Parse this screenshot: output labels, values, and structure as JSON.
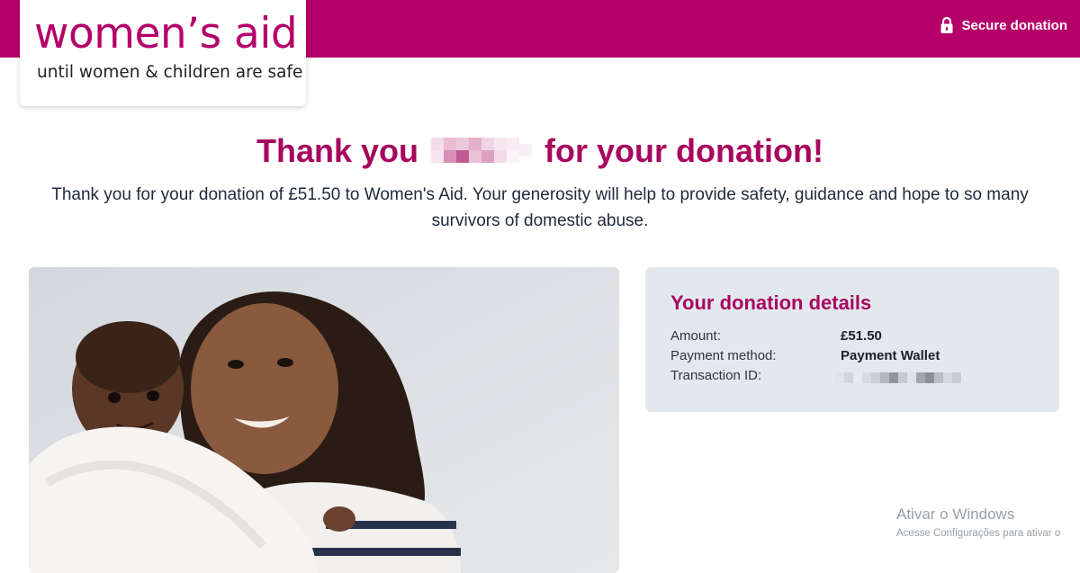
{
  "header": {
    "secure_label": "Secure donation",
    "lock_icon": "lock-icon",
    "accent_color": "#b5006a"
  },
  "logo": {
    "name": "women’s aid",
    "tagline": "until women & children are safe"
  },
  "main": {
    "headline_start": "Thank you",
    "headline_end": "for your donation!",
    "intro": "Thank you for your donation of £51.50 to Women's Aid. Your generosity will help to provide safety, guidance and hope to so many survivors of domestic abuse."
  },
  "details": {
    "title": "Your donation details",
    "rows": [
      {
        "label": "Amount:",
        "value": "£51.50"
      },
      {
        "label": "Payment method:",
        "value": "Payment Wallet"
      },
      {
        "label": "Transaction ID:",
        "value": ""
      }
    ]
  },
  "watermark": {
    "line1": "Ativar o Windows",
    "line2": "Acesse Configurações para ativar o"
  }
}
